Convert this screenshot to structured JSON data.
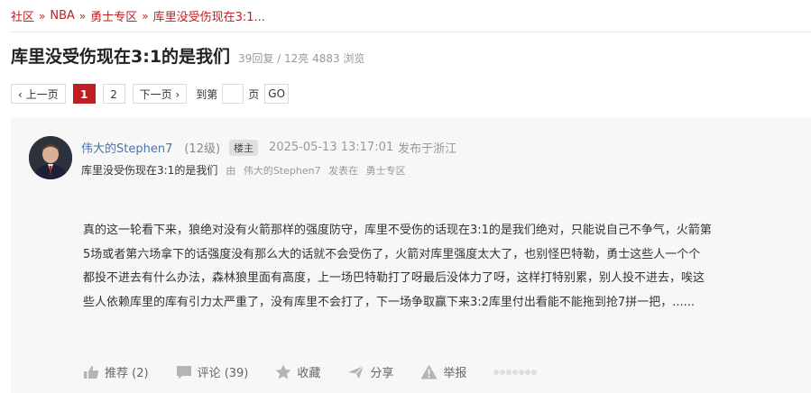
{
  "breadcrumb": {
    "items": [
      "社区",
      "NBA",
      "勇士专区",
      "库里没受伤现在3:1..."
    ],
    "separator": "»"
  },
  "thread": {
    "title": "库里没受伤现在3:1的是我们",
    "stats": "39回复 / 12亮 4883 浏览"
  },
  "pager": {
    "prev_label": "‹ 上一页",
    "pages": [
      "1",
      "2"
    ],
    "current_page": "1",
    "next_label": "下一页 ›",
    "goto_label": "到第",
    "goto_value": "",
    "page_unit": "页",
    "go_label": "GO"
  },
  "post": {
    "author": "伟大的Stephen7",
    "level": "(12级)",
    "badge": "楼主",
    "time": "2025-05-13 13:17:01",
    "location": "发布于浙江",
    "subtitle": "库里没受伤现在3:1的是我们",
    "sub_by": "由",
    "sub_author": "伟大的Stephen7",
    "sub_posted_in": "发表在",
    "sub_forum": "勇士专区",
    "body_lines": [
      "真的这一轮看下来，狼绝对没有火箭那样的强度防守，库里不受伤的话现在3:1的是我们绝对，只能说自己不争气，火箭第",
      "5场或者第六场拿下的话强度没有那么大的话就不会受伤了，火箭对库里强度太大了，也别怪巴特勒，勇士这些人一个个",
      "都投不进去有什么办法，森林狼里面有高度，上一场巴特勒打了呀最后没体力了呀，这样打特别累，别人投不进去，唉这",
      "些人依赖库里的库有引力太严重了，没有库里不会打了，下一场争取赢下来3:2库里付出看能不能拖到抢7拼一把，......"
    ]
  },
  "actions": {
    "recommend": "推荐 (2)",
    "comment": "评论 (39)",
    "favorite": "收藏",
    "share": "分享",
    "report": "举报"
  },
  "colors": {
    "accent": "#c01e22",
    "author_link": "#4a72ad",
    "card_bg": "#f7f7f7"
  }
}
